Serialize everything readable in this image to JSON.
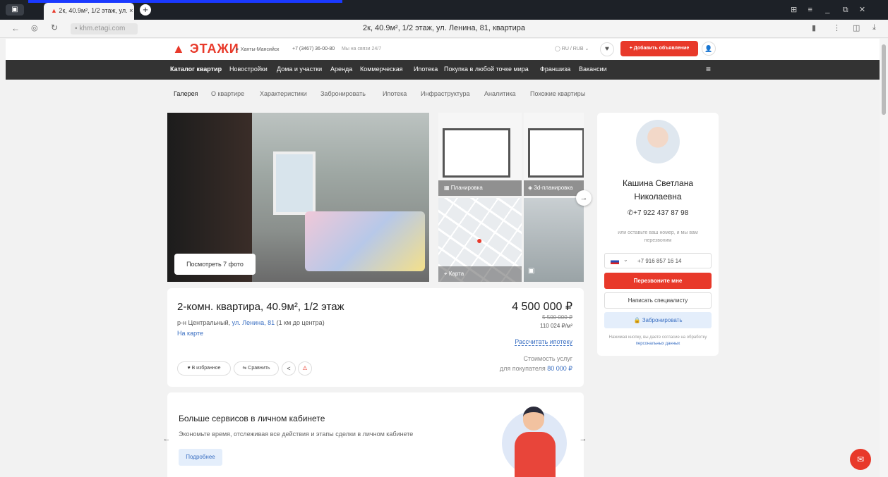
{
  "browser": {
    "tab_title": "2к, 40.9м², 1/2 этаж, ул. ×",
    "url": "khm.etagi.com",
    "page_title": "2к, 40.9м², 1/2 этаж, ул. Ленина, 81, квартира"
  },
  "header": {
    "logo": "ЭТАЖИ",
    "city": "Ханты-Мансийск",
    "phone": "+7 (3467) 36-00-80",
    "hours": "Мы на связи 24/7",
    "lang": "RU / RUB",
    "add_listing": "+ Добавить объявление"
  },
  "nav": [
    "Каталог квартир",
    "Новостройки",
    "Дома и участки",
    "Аренда",
    "Коммерческая",
    "Ипотека",
    "Покупка в любой точке мира",
    "Франшиза",
    "Вакансии"
  ],
  "subnav": [
    "Галерея",
    "О квартире",
    "Характеристики",
    "Забронировать",
    "Ипотека",
    "Инфраструктура",
    "Аналитика",
    "Похожие квартиры"
  ],
  "gallery": {
    "view_photos": "Посмотреть 7 фото",
    "plan": "Планировка",
    "plan3d": "3d-планировка",
    "map": "Карта"
  },
  "listing": {
    "title": "2-комн. квартира, 40.9м², 1/2 этаж",
    "district": "р-н Центральный,",
    "street": "ул. Ленина, 81",
    "distance": "(1 км до центра)",
    "on_map": "На карте",
    "price": "4 500 000 ₽",
    "old_price": "5 500 000 ₽",
    "price_per_m": "110 024 ₽/м²",
    "calc_mortgage": "Рассчитать ипотеку",
    "services_label": "Стоимость услуг",
    "services_for": "для покупателя",
    "services_price": "80 000 ₽",
    "fav": "В избранное",
    "compare": "Сравнить"
  },
  "agent": {
    "name_line1": "Кашина Светлана",
    "name_line2": "Николаевна",
    "phone": "+7 922 437 87 98",
    "hint": "или оставьте ваш номер, и мы вам перезвоним",
    "input_phone": "+7 916 857 16 14",
    "call_me": "Перезвоните мне",
    "write": "Написать специалисту",
    "book": "Забронировать",
    "consent_text": "Нажимая кнопку, вы даете согласие на обработку",
    "consent_link": "персональных данных"
  },
  "promo": {
    "title": "Больше сервисов в личном кабинете",
    "text": "Экономьте время, отслеживая все действия и этапы сделки в личном кабинете",
    "more": "Подробнее"
  },
  "colors": {
    "brand": "#e8392a",
    "link": "#3a6fc2",
    "nav": "#333333"
  }
}
